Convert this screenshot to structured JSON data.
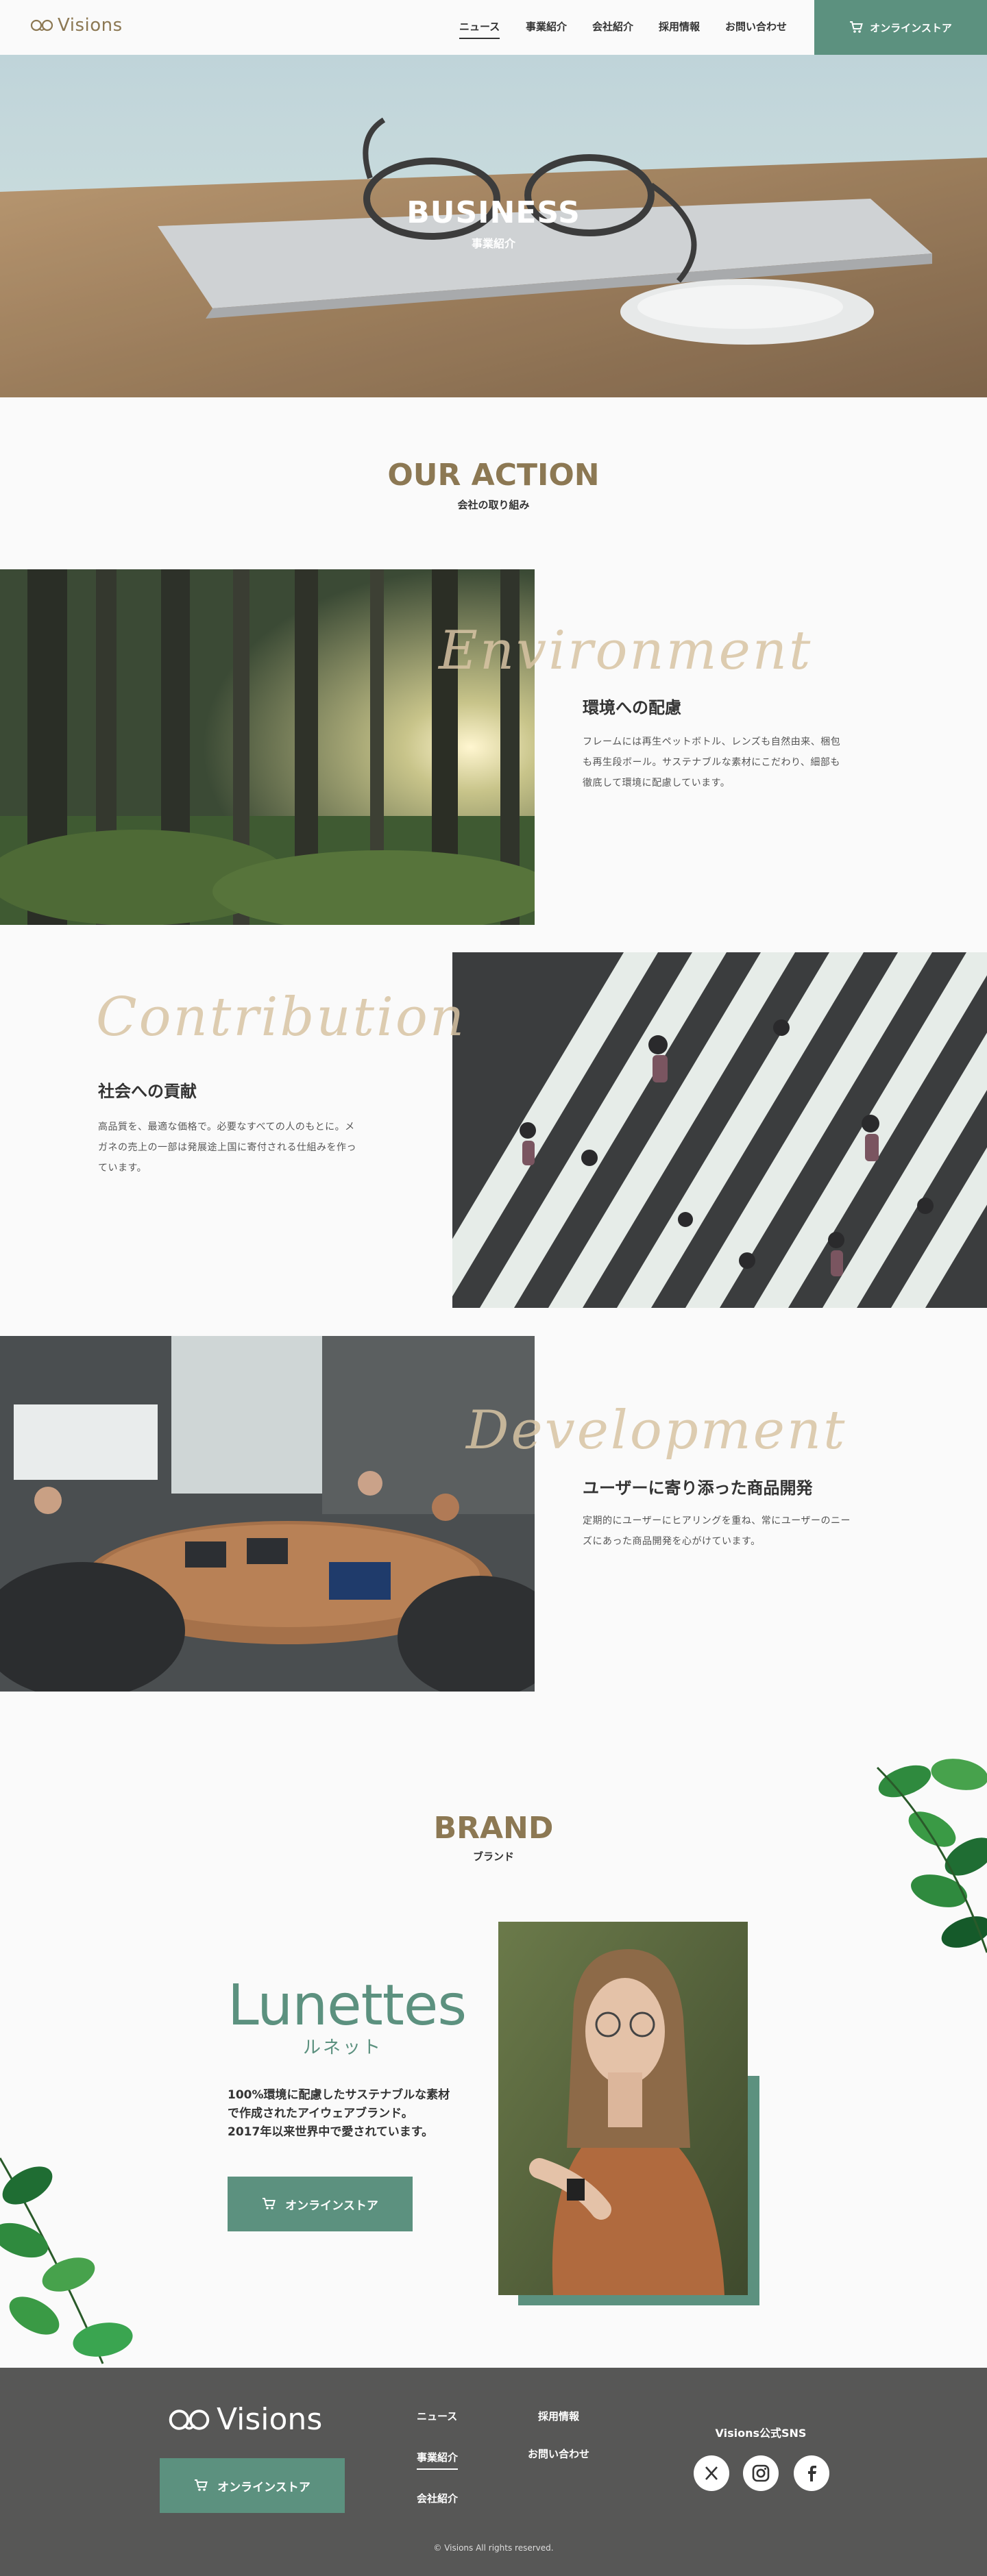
{
  "header": {
    "logo_text": "Visions",
    "nav": [
      {
        "label": "ニュース",
        "active": true
      },
      {
        "label": "事業紹介"
      },
      {
        "label": "会社紹介"
      },
      {
        "label": "採用情報"
      },
      {
        "label": "お問い合わせ"
      }
    ],
    "store_label": "オンラインストア"
  },
  "hero": {
    "title": "BUSINESS",
    "subtitle": "事業紹介"
  },
  "action": {
    "title": "OUR ACTION",
    "subtitle": "会社の取り組み",
    "items": [
      {
        "script": "Environment",
        "heading": "環境への配慮",
        "lines": [
          "フレームには再生ペットボトル、レンズも自然由来、梱包",
          "も再生段ボール。サステナブルな素材にこだわり、細部も",
          "徹底して環境に配慮しています。"
        ]
      },
      {
        "script": "Contribution",
        "heading": "社会への貢献",
        "lines": [
          "高品質を、最適な価格で。必要なすべての人のもとに。メ",
          "ガネの売上の一部は発展途上国に寄付される仕組みを作っ",
          "ています。"
        ]
      },
      {
        "script": "Development",
        "heading": "ユーザーに寄り添った商品開発",
        "lines": [
          "定期的にユーザーにヒアリングを重ね、常にユーザーのニー",
          "ズにあった商品開発を心がけています。"
        ]
      }
    ]
  },
  "brand": {
    "title": "BRAND",
    "subtitle": "ブランド",
    "name": "Lunettes",
    "name_kana": "ルネット",
    "lines": [
      "100%環境に配慮したサステナブルな素材",
      "で作成されたアイウェアブランド。",
      "2017年以来世界中で愛されています。"
    ],
    "button_label": "オンラインストア"
  },
  "footer": {
    "logo_text": "Visions",
    "store_label": "オンラインストア",
    "links_col1": [
      "ニュース",
      "事業紹介",
      "会社紹介"
    ],
    "links_col2": [
      "採用情報",
      "お問い合わせ"
    ],
    "sns_title": "Visions公式SNS",
    "sns_icons": [
      "x-icon",
      "instagram-icon",
      "facebook-icon"
    ],
    "copyright": "© Visions All rights reserved."
  },
  "colors": {
    "accent": "#5c917f",
    "gold": "#8c7853",
    "footer_bg": "#575756"
  }
}
